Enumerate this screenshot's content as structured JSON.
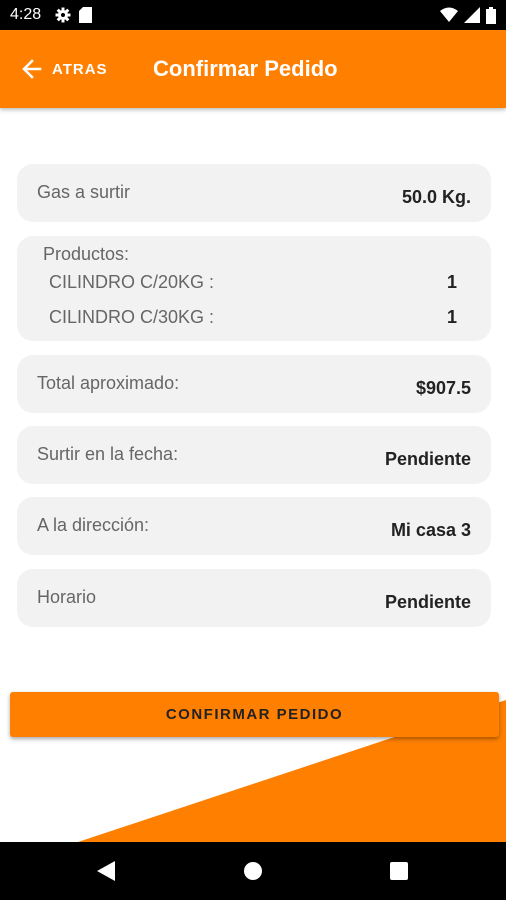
{
  "status_bar": {
    "time": "4:28",
    "left_icons": [
      "gear-icon",
      "sd-card-icon"
    ],
    "right_icons": [
      "wifi-icon",
      "signal-icon",
      "battery-icon"
    ]
  },
  "header": {
    "back_label": "ATRAS",
    "title": "Confirmar Pedido",
    "background": "#ff7f00"
  },
  "gas": {
    "label": "Gas a surtir",
    "value": "50.0 Kg."
  },
  "products": {
    "title": "Productos:",
    "items": [
      {
        "name": "CILINDRO C/20KG :",
        "qty": "1"
      },
      {
        "name": "CILINDRO C/30KG :",
        "qty": "1"
      }
    ]
  },
  "total": {
    "label": "Total aproximado:",
    "value": "$907.5"
  },
  "date": {
    "label": "Surtir en la fecha:",
    "value": "Pendiente"
  },
  "address": {
    "label": "A la dirección:",
    "value": "Mi casa 3"
  },
  "schedule": {
    "label": "Horario",
    "value": "Pendiente"
  },
  "confirm_button": {
    "label": "CONFIRMAR PEDIDO"
  },
  "colors": {
    "accent": "#ff7f00",
    "card": "#f2f2f2"
  },
  "nav_bar": {
    "icons": [
      "back-triangle-icon",
      "home-circle-icon",
      "recents-square-icon"
    ]
  }
}
